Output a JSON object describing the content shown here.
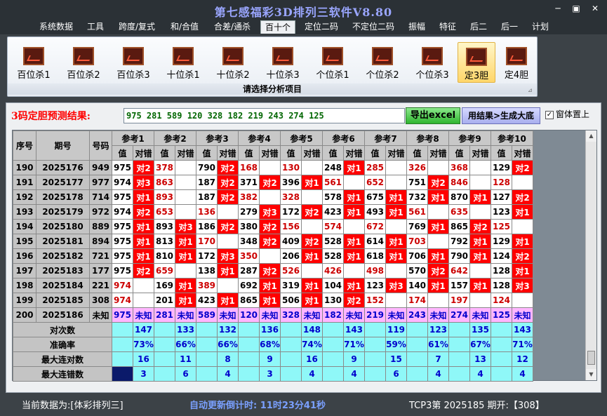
{
  "window": {
    "title": "第七感福彩3D排列三软件V8.80",
    "minimize": "─",
    "maximize": "▣",
    "close": "✕"
  },
  "menu": [
    "系统数据",
    "工具",
    "跨度/复式",
    "和/合值",
    "合差/通杀",
    "百十个",
    "定位二码",
    "不定位二码",
    "振幅",
    "特征",
    "后二",
    "后一",
    "计划"
  ],
  "ribbon": {
    "buttons": [
      "百位杀1",
      "百位杀2",
      "百位杀3",
      "十位杀1",
      "十位杀2",
      "十位杀3",
      "个位杀1",
      "个位杀2",
      "个位杀3",
      "定3胆",
      "定4胆"
    ],
    "active": "定3胆",
    "caption": "请选择分析项目",
    "launcher": "⊿"
  },
  "prediction": {
    "label": "3码定胆预测结果:",
    "value": "975  281  589  120  328  182  219  243  274  125",
    "export_label": "导出excel",
    "generate_label": "用结果>生成大底",
    "topmost_label": "窗体置上",
    "topmost_checked": "✓"
  },
  "table": {
    "col_seq": "序号",
    "col_issue": "期号",
    "col_code": "号码",
    "refs": [
      "参考1",
      "参考2",
      "参考3",
      "参考4",
      "参考5",
      "参考6",
      "参考7",
      "参考8",
      "参考9",
      "参考10"
    ],
    "sub_val": "值",
    "sub_res": "对错",
    "rows": [
      {
        "seq": "190",
        "issue": "2025176",
        "code": "949",
        "cells": [
          [
            "975",
            "对2"
          ],
          [
            "378",
            ""
          ],
          [
            "790",
            "对2"
          ],
          [
            "168",
            ""
          ],
          [
            "130",
            ""
          ],
          [
            "248",
            "对1"
          ],
          [
            "285",
            ""
          ],
          [
            "326",
            ""
          ],
          [
            "368",
            ""
          ],
          [
            "129",
            "对2"
          ]
        ]
      },
      {
        "seq": "191",
        "issue": "2025177",
        "code": "977",
        "cells": [
          [
            "974",
            "对3"
          ],
          [
            "863",
            ""
          ],
          [
            "187",
            "对2"
          ],
          [
            "371",
            "对2"
          ],
          [
            "396",
            "对1"
          ],
          [
            "561",
            ""
          ],
          [
            "652",
            ""
          ],
          [
            "751",
            "对2"
          ],
          [
            "846",
            ""
          ],
          [
            "128",
            ""
          ]
        ]
      },
      {
        "seq": "192",
        "issue": "2025178",
        "code": "714",
        "cells": [
          [
            "975",
            "对1"
          ],
          [
            "893",
            ""
          ],
          [
            "187",
            "对2"
          ],
          [
            "382",
            ""
          ],
          [
            "328",
            ""
          ],
          [
            "578",
            "对1"
          ],
          [
            "675",
            "对1"
          ],
          [
            "732",
            "对1"
          ],
          [
            "870",
            "对1"
          ],
          [
            "127",
            "对2"
          ]
        ]
      },
      {
        "seq": "193",
        "issue": "2025179",
        "code": "972",
        "cells": [
          [
            "974",
            "对2"
          ],
          [
            "653",
            ""
          ],
          [
            "136",
            ""
          ],
          [
            "279",
            "对3"
          ],
          [
            "172",
            "对2"
          ],
          [
            "423",
            "对1"
          ],
          [
            "493",
            "对1"
          ],
          [
            "561",
            ""
          ],
          [
            "635",
            ""
          ],
          [
            "123",
            "对1"
          ]
        ]
      },
      {
        "seq": "194",
        "issue": "2025180",
        "code": "889",
        "cells": [
          [
            "975",
            "对1"
          ],
          [
            "893",
            "对3"
          ],
          [
            "186",
            "对2"
          ],
          [
            "380",
            "对2"
          ],
          [
            "156",
            ""
          ],
          [
            "574",
            ""
          ],
          [
            "672",
            ""
          ],
          [
            "769",
            "对1"
          ],
          [
            "865",
            "对2"
          ],
          [
            "125",
            ""
          ]
        ]
      },
      {
        "seq": "195",
        "issue": "2025181",
        "code": "894",
        "cells": [
          [
            "975",
            "对1"
          ],
          [
            "813",
            "对1"
          ],
          [
            "170",
            ""
          ],
          [
            "348",
            "对2"
          ],
          [
            "409",
            "对2"
          ],
          [
            "528",
            "对1"
          ],
          [
            "614",
            "对1"
          ],
          [
            "703",
            ""
          ],
          [
            "792",
            "对1"
          ],
          [
            "129",
            "对1"
          ]
        ]
      },
      {
        "seq": "196",
        "issue": "2025182",
        "code": "721",
        "cells": [
          [
            "975",
            "对1"
          ],
          [
            "810",
            "对1"
          ],
          [
            "172",
            "对3"
          ],
          [
            "350",
            ""
          ],
          [
            "206",
            "对1"
          ],
          [
            "528",
            "对1"
          ],
          [
            "618",
            "对1"
          ],
          [
            "706",
            "对1"
          ],
          [
            "790",
            "对1"
          ],
          [
            "124",
            "对2"
          ]
        ]
      },
      {
        "seq": "197",
        "issue": "2025183",
        "code": "177",
        "cells": [
          [
            "975",
            "对2"
          ],
          [
            "659",
            ""
          ],
          [
            "138",
            "对1"
          ],
          [
            "287",
            "对2"
          ],
          [
            "526",
            ""
          ],
          [
            "426",
            ""
          ],
          [
            "498",
            ""
          ],
          [
            "570",
            "对2"
          ],
          [
            "642",
            ""
          ],
          [
            "128",
            "对1"
          ]
        ]
      },
      {
        "seq": "198",
        "issue": "2025184",
        "code": "221",
        "cells": [
          [
            "974",
            ""
          ],
          [
            "169",
            "对1"
          ],
          [
            "389",
            ""
          ],
          [
            "692",
            "对1"
          ],
          [
            "319",
            "对1"
          ],
          [
            "104",
            "对1"
          ],
          [
            "123",
            "对3"
          ],
          [
            "140",
            "对1"
          ],
          [
            "157",
            "对1"
          ],
          [
            "128",
            "对3"
          ]
        ]
      },
      {
        "seq": "199",
        "issue": "2025185",
        "code": "308",
        "cells": [
          [
            "974",
            ""
          ],
          [
            "201",
            "对1"
          ],
          [
            "423",
            "对1"
          ],
          [
            "865",
            "对1"
          ],
          [
            "506",
            "对1"
          ],
          [
            "130",
            "对2"
          ],
          [
            "152",
            ""
          ],
          [
            "174",
            ""
          ],
          [
            "197",
            ""
          ],
          [
            "124",
            ""
          ]
        ]
      },
      {
        "seq": "200",
        "issue": "2025186",
        "code": "未知",
        "cells": [
          [
            "975",
            "未知"
          ],
          [
            "281",
            "未知"
          ],
          [
            "589",
            "未知"
          ],
          [
            "120",
            "未知"
          ],
          [
            "328",
            "未知"
          ],
          [
            "182",
            "未知"
          ],
          [
            "219",
            "未知"
          ],
          [
            "243",
            "未知"
          ],
          [
            "274",
            "未知"
          ],
          [
            "125",
            "未知"
          ]
        ]
      }
    ],
    "stats": [
      {
        "label": "对次数",
        "values": [
          "147",
          "133",
          "132",
          "136",
          "148",
          "143",
          "119",
          "123",
          "135",
          "143"
        ]
      },
      {
        "label": "准确率",
        "values": [
          "73%",
          "66%",
          "66%",
          "68%",
          "74%",
          "71%",
          "59%",
          "61%",
          "67%",
          "71%"
        ]
      },
      {
        "label": "最大连对数",
        "values": [
          "16",
          "11",
          "8",
          "9",
          "16",
          "9",
          "15",
          "7",
          "13",
          "12"
        ]
      },
      {
        "label": "最大连错数",
        "values": [
          "3",
          "6",
          "4",
          "3",
          "4",
          "4",
          "6",
          "4",
          "4",
          "4"
        ]
      }
    ]
  },
  "scrollbar": {
    "up": "▲",
    "down": "▼"
  },
  "status": {
    "data_source": "当前数据为:[体彩排列三]",
    "timer": "自动更新倒计时:  11时23分41秒",
    "draw": "TCP3第 2025185 期开:【308】"
  }
}
